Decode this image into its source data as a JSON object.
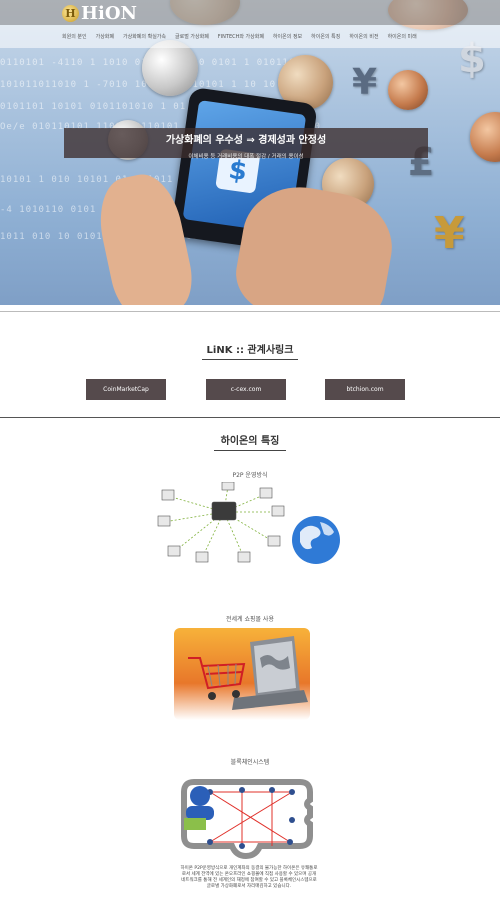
{
  "header": {
    "logo_text": "HiON",
    "logo_mark": "H",
    "menu": [
      "회원의 분인",
      "가상화폐",
      "가상화폐의 확실가속",
      "글로벌 가상화폐",
      "FINTECH와 가상화폐",
      "하이온의 정보",
      "하이온의 특징",
      "하이온의 비전",
      "하이온의 미래"
    ]
  },
  "hero": {
    "headline": "가상화폐의 우수성 ⇒ 경제성과 안정성",
    "subline": "이체비용 등 거래비용의 대폭 절감 / 거래의 용이성",
    "matrix_lines": [
      "0110101  -4110  1 1010 01011010110 0101 1 010110",
      "101011011010 1 -7010 1010  1  0110101  1 10 10",
      "0101101 10101 0101101010 1 01 0101101 011010 1",
      "Oe/e 010110101 1101010110101 01010110101 1 101 110",
      "10101  1 010 10101 01  101011  0 1010 1010110 10",
      "-4  1010110 0101 10 1011 10101 11010 010 10101",
      "1011 010 10  01010110 1 01 01101 10101 0101 10"
    ],
    "symbols": [
      "¥",
      "$",
      "£",
      "¥",
      "€",
      "$"
    ]
  },
  "links": {
    "title": "LiNK :: 관계사링크",
    "buttons": [
      "CoinMarketCap",
      "c-cex.com",
      "btchion.com"
    ]
  },
  "features": {
    "title": "하이온의 특징",
    "items": [
      {
        "caption": "P2P 운영방식"
      },
      {
        "caption": "전세계 쇼핑몰 사용"
      },
      {
        "caption": "블록체인시스템"
      }
    ],
    "description": "하이온 P2P운영방식으로 개인계좌의 동결의 불가능한 하이온은 유쾌통로로서 세계 전역에 있는 온오프라인 쇼핑몰에 직접 사용할 수 있으며 공개 네트워크를 통해 전 세계인의 재정에 참여할 수 있고 블록체인시스템으로 글로벌 가상화폐로서 자리매김하고 있습니다."
  },
  "colors": {
    "button_bg": "#554a4c",
    "banner_bg": "#3c2d2d",
    "accent_line": "#555555"
  }
}
